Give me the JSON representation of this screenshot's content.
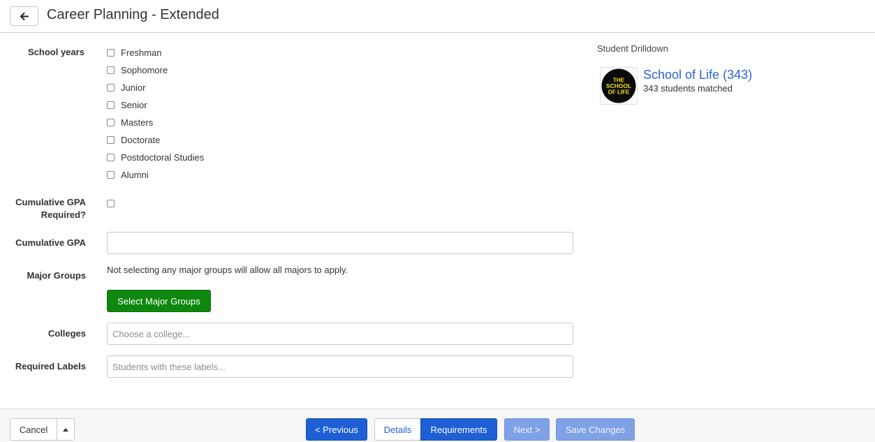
{
  "header": {
    "title": "Career Planning - Extended",
    "back_icon": "arrow-left-icon"
  },
  "form": {
    "school_years": {
      "label": "School years",
      "options": [
        "Freshman",
        "Sophomore",
        "Junior",
        "Senior",
        "Masters",
        "Doctorate",
        "Postdoctoral Studies",
        "Alumni"
      ]
    },
    "gpa_required": {
      "label_line1": "Cumulative GPA",
      "label_line2": "Required?"
    },
    "gpa": {
      "label": "Cumulative GPA",
      "value": ""
    },
    "major_groups": {
      "label": "Major Groups",
      "help": "Not selecting any major groups will allow all majors to apply.",
      "button": "Select Major Groups"
    },
    "colleges": {
      "label": "Colleges",
      "placeholder": "Choose a college..."
    },
    "required_labels": {
      "label": "Required Labels",
      "placeholder": "Students with these labels..."
    }
  },
  "drilldown": {
    "title": "Student Drilldown",
    "logo_text": [
      "THE",
      "SCHOOL",
      "OF LIFE"
    ],
    "name": "School of Life (343)",
    "subtitle": "343 students matched"
  },
  "footer": {
    "cancel": "Cancel",
    "previous": "< Previous",
    "tab_details": "Details",
    "tab_requirements": "Requirements",
    "next": "Next >",
    "save": "Save Changes"
  },
  "colors": {
    "primary": "#1f5fd6",
    "success": "#0e870e",
    "link": "#2a62d6"
  }
}
